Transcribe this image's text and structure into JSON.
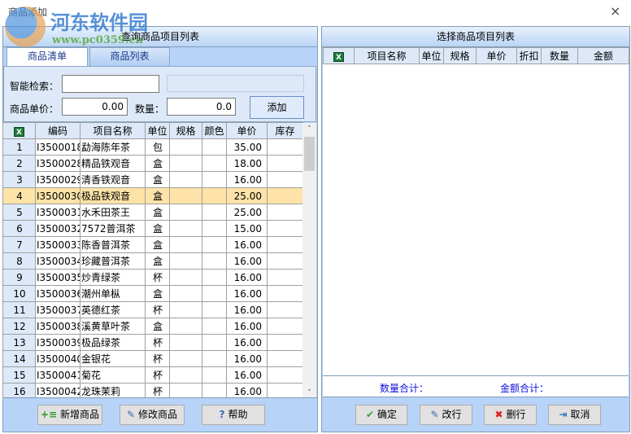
{
  "window": {
    "title": "商品添加",
    "close": "×"
  },
  "watermark": {
    "name": "河东软件园",
    "url": "www.pc0359.cn"
  },
  "left": {
    "header": "查询商品项目列表",
    "tabs": [
      {
        "label": "商品清单",
        "active": true
      },
      {
        "label": "商品列表",
        "active": false
      }
    ],
    "search_label": "智能检索：",
    "search_value": "",
    "price_label": "商品单价：",
    "price_value": "0.00",
    "qty_label": "数量：",
    "qty_value": "0.0",
    "add_button": "添加",
    "columns": [
      "编码",
      "项目名称",
      "单位",
      "规格",
      "颜色",
      "单价",
      "库存"
    ],
    "rows": [
      [
        "1",
        "I3500018",
        "勐海陈年茶",
        "包",
        "",
        "",
        "35.00",
        ""
      ],
      [
        "2",
        "I3500028",
        "精品铁观音",
        "盒",
        "",
        "",
        "18.00",
        ""
      ],
      [
        "3",
        "I3500029",
        "清香铁观音",
        "盒",
        "",
        "",
        "16.00",
        ""
      ],
      [
        "4",
        "I3500030",
        "极品铁观音",
        "盒",
        "",
        "",
        "25.00",
        ""
      ],
      [
        "5",
        "I3500031",
        "水禾田茶王",
        "盒",
        "",
        "",
        "25.00",
        ""
      ],
      [
        "6",
        "I3500032",
        "7572普洱茶",
        "盒",
        "",
        "",
        "15.00",
        ""
      ],
      [
        "7",
        "I3500033",
        "陈香普洱茶",
        "盒",
        "",
        "",
        "16.00",
        ""
      ],
      [
        "8",
        "I3500034",
        "珍藏普洱茶",
        "盒",
        "",
        "",
        "16.00",
        ""
      ],
      [
        "9",
        "I3500035",
        "炒青绿茶",
        "杯",
        "",
        "",
        "16.00",
        ""
      ],
      [
        "10",
        "I3500036",
        "潮州单枞",
        "盒",
        "",
        "",
        "16.00",
        ""
      ],
      [
        "11",
        "I3500037",
        "英德红茶",
        "杯",
        "",
        "",
        "16.00",
        ""
      ],
      [
        "12",
        "I3500038",
        "溪黄草叶茶",
        "盒",
        "",
        "",
        "16.00",
        ""
      ],
      [
        "13",
        "I3500039",
        "极品绿茶",
        "杯",
        "",
        "",
        "16.00",
        ""
      ],
      [
        "14",
        "I3500040",
        "金银花",
        "杯",
        "",
        "",
        "16.00",
        ""
      ],
      [
        "15",
        "I3500041",
        "菊花",
        "杯",
        "",
        "",
        "16.00",
        ""
      ],
      [
        "16",
        "I3500042",
        "龙珠茉莉",
        "杯",
        "",
        "",
        "16.00",
        ""
      ]
    ],
    "selected_row": 4,
    "buttons": [
      "新增商品",
      "修改商品",
      "帮助"
    ]
  },
  "right": {
    "header": "选择商品项目列表",
    "columns": [
      "项目名称",
      "单位",
      "规格",
      "单价",
      "折扣",
      "数量",
      "金额"
    ],
    "qty_total_label": "数量合计：",
    "amount_total_label": "金额合计：",
    "buttons": [
      "确定",
      "改行",
      "删行",
      "取消"
    ]
  },
  "colors": {
    "panel": "#b7d3f7",
    "selected_row": "#fde3a7",
    "total_label": "#1010e0"
  }
}
